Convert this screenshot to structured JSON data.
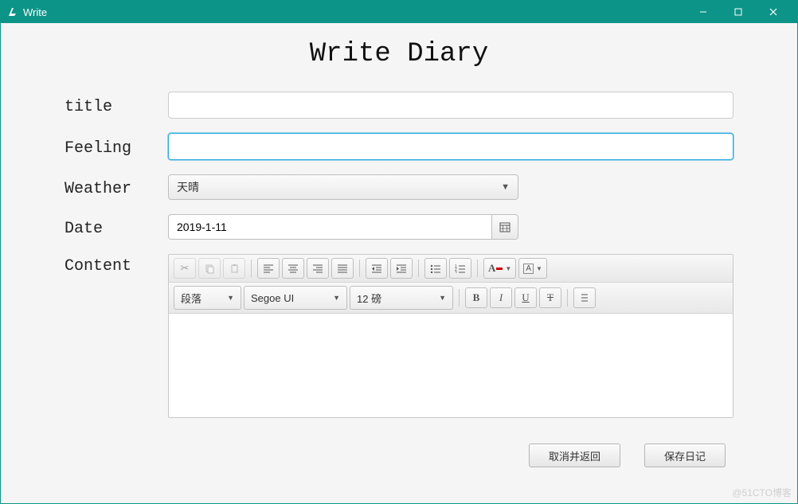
{
  "window": {
    "title": "Write"
  },
  "page": {
    "heading": "Write Diary"
  },
  "labels": {
    "title": "title",
    "feeling": "Feeling",
    "weather": "Weather",
    "date": "Date",
    "content": "Content"
  },
  "fields": {
    "title_value": "",
    "feeling_value": "",
    "weather_selected": "天晴",
    "date_value": "2019-1-11",
    "content_value": ""
  },
  "editor": {
    "paragraph": "段落",
    "font": "Segoe UI",
    "size": "12 磅"
  },
  "buttons": {
    "cancel": "取消并返回",
    "save": "保存日记"
  },
  "watermark": "@51CTO博客"
}
